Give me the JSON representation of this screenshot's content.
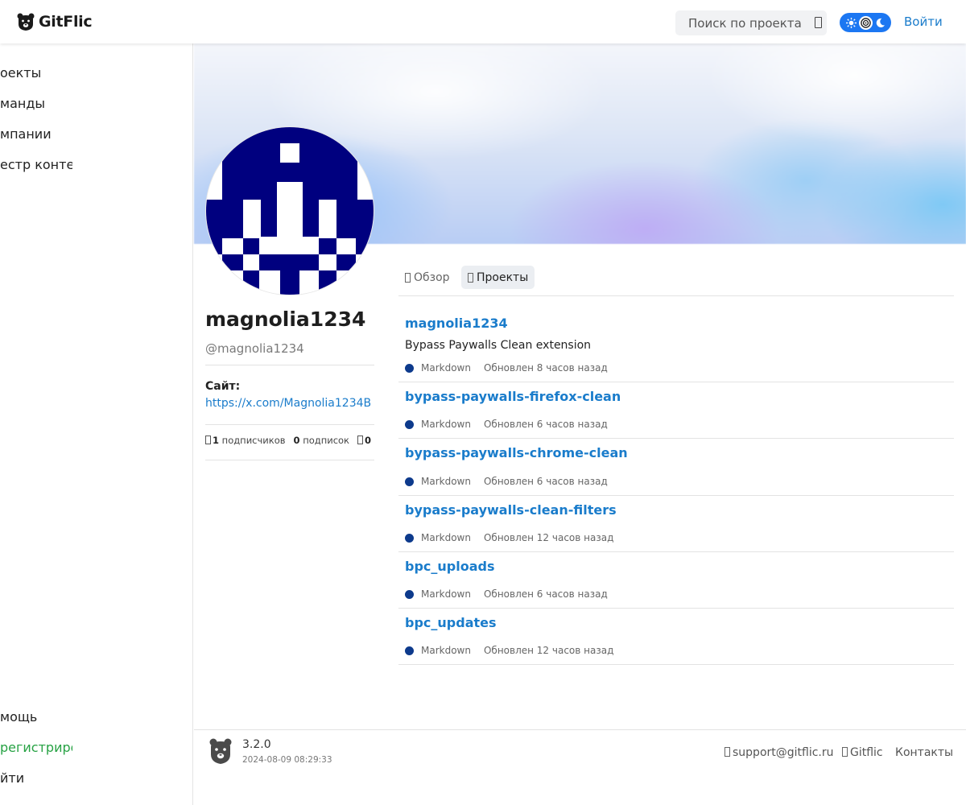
{
  "header": {
    "logo_text": "GitFlic",
    "search_placeholder": "Поиск по проекта",
    "login_label": "Войти",
    "theme_options": [
      "light-icon",
      "auto-icon",
      "dark-icon"
    ]
  },
  "sidebar": {
    "items": [
      {
        "label": "оекты"
      },
      {
        "label": "манды"
      },
      {
        "label": "мпании"
      },
      {
        "label": "естр контеі"
      }
    ],
    "bottom_items": [
      {
        "label": "мощь"
      },
      {
        "label": "регистриро",
        "color": "#27a244"
      },
      {
        "label": "йти"
      }
    ]
  },
  "profile": {
    "name": "magnolia1234",
    "handle": "@magnolia1234",
    "site_label": "Сайт:",
    "site_url": "https://x.com/Magnolia1234B",
    "stats": {
      "followers_count": "1",
      "followers_label": "подписчиков",
      "following_count": "0",
      "following_label": "подписок",
      "stars_count": "0"
    }
  },
  "tabs": [
    {
      "label": "Обзор",
      "active": false
    },
    {
      "label": "Проекты",
      "active": true
    }
  ],
  "projects": [
    {
      "title": "magnolia1234",
      "description": "Bypass Paywalls Clean extension",
      "language": "Markdown",
      "updated": "Обновлен 8 часов назад"
    },
    {
      "title": "bypass-paywalls-firefox-clean",
      "description": "",
      "language": "Markdown",
      "updated": "Обновлен 6 часов назад"
    },
    {
      "title": "bypass-paywalls-chrome-clean",
      "description": "",
      "language": "Markdown",
      "updated": "Обновлен 6 часов назад"
    },
    {
      "title": "bypass-paywalls-clean-filters",
      "description": "",
      "language": "Markdown",
      "updated": "Обновлен 12 часов назад"
    },
    {
      "title": "bpc_uploads",
      "description": "",
      "language": "Markdown",
      "updated": "Обновлен 6 часов назад"
    },
    {
      "title": "bpc_updates",
      "description": "",
      "language": "Markdown",
      "updated": "Обновлен 12 часов назад"
    }
  ],
  "footer": {
    "version": "3.2.0",
    "build_date": "2024-08-09 08:29:33",
    "links": [
      {
        "label": "support@gitflic.ru"
      },
      {
        "label": "Gitflic"
      },
      {
        "label": "Контакты"
      }
    ]
  },
  "colors": {
    "accent": "#1a7ccb",
    "toggle": "#1c77f2",
    "language_dot": "#0d3a8c",
    "avatar": "#00007f",
    "register_green": "#27a244"
  }
}
